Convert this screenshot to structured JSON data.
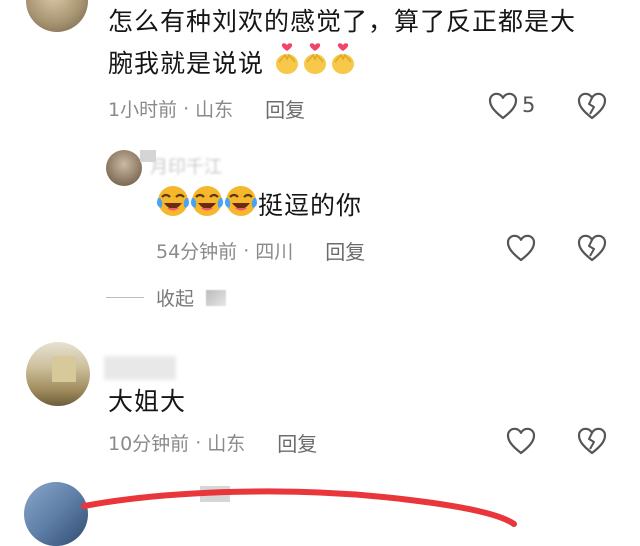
{
  "comments": [
    {
      "text": "怎么有种刘欢的感觉了，算了反正都是大腕我就是说说",
      "line1": "怎么有种刘欢的感觉了，算了反正都是大",
      "line2": "腕我就是说说",
      "emoji": [
        "heart-hands",
        "heart-hands",
        "heart-hands"
      ],
      "time": "1小时前",
      "location": "山东",
      "reply_label": "回复",
      "likes": "5"
    },
    {
      "username": "月印千江",
      "emoji": [
        "laughing-crying",
        "laughing-crying",
        "laughing-crying"
      ],
      "text": "挺逗的你",
      "time": "54分钟前",
      "location": "四川",
      "reply_label": "回复"
    },
    {
      "collapse_label": "收起"
    },
    {
      "text": "大姐大",
      "time": "10分钟前",
      "location": "山东",
      "reply_label": "回复"
    }
  ],
  "separator": "·",
  "colors": {
    "text": "#161616",
    "meta": "#8a8a8a",
    "annotation_stroke": "#e8363a"
  }
}
